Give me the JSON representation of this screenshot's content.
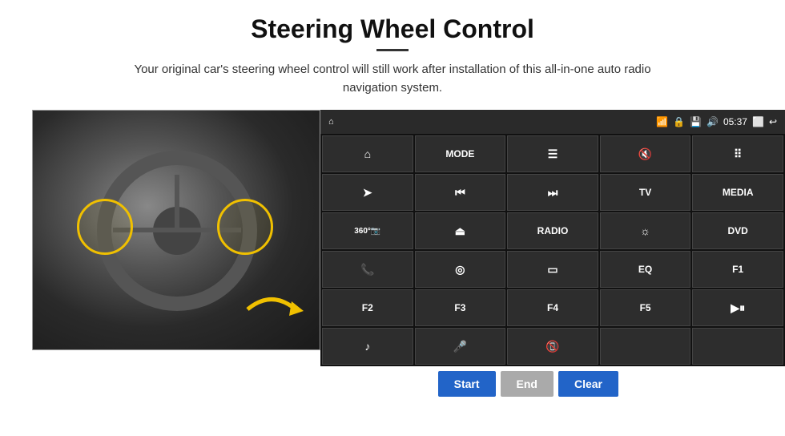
{
  "header": {
    "title": "Steering Wheel Control",
    "subtitle": "Your original car's steering wheel control will still work after installation of this all-in-one auto radio navigation system."
  },
  "status_bar": {
    "wifi_icon": "wifi",
    "lock_icon": "🔒",
    "sd_icon": "💾",
    "bt_icon": "🔊",
    "time": "05:37",
    "screen_icon": "⬜",
    "back_icon": "↩"
  },
  "grid_cells": [
    {
      "id": "home",
      "label": "⌂",
      "type": "icon"
    },
    {
      "id": "mode",
      "label": "MODE",
      "type": "text"
    },
    {
      "id": "list",
      "label": "☰",
      "type": "icon"
    },
    {
      "id": "mute",
      "label": "🔇",
      "type": "icon"
    },
    {
      "id": "apps",
      "label": "⋮⋮",
      "type": "icon"
    },
    {
      "id": "nav",
      "label": "➤",
      "type": "icon"
    },
    {
      "id": "prev",
      "label": "⏮",
      "type": "icon"
    },
    {
      "id": "next",
      "label": "⏭",
      "type": "icon"
    },
    {
      "id": "tv",
      "label": "TV",
      "type": "text"
    },
    {
      "id": "media",
      "label": "MEDIA",
      "type": "text"
    },
    {
      "id": "360cam",
      "label": "360°",
      "type": "icon"
    },
    {
      "id": "eject",
      "label": "⏏",
      "type": "icon"
    },
    {
      "id": "radio",
      "label": "RADIO",
      "type": "text"
    },
    {
      "id": "brightness",
      "label": "☼",
      "type": "icon"
    },
    {
      "id": "dvd",
      "label": "DVD",
      "type": "text"
    },
    {
      "id": "phone",
      "label": "📞",
      "type": "icon"
    },
    {
      "id": "swipe",
      "label": "◎",
      "type": "icon"
    },
    {
      "id": "rect",
      "label": "▭",
      "type": "icon"
    },
    {
      "id": "eq",
      "label": "EQ",
      "type": "text"
    },
    {
      "id": "f1",
      "label": "F1",
      "type": "text"
    },
    {
      "id": "f2",
      "label": "F2",
      "type": "text"
    },
    {
      "id": "f3",
      "label": "F3",
      "type": "text"
    },
    {
      "id": "f4",
      "label": "F4",
      "type": "text"
    },
    {
      "id": "f5",
      "label": "F5",
      "type": "text"
    },
    {
      "id": "playpause",
      "label": "▶⏸",
      "type": "icon"
    },
    {
      "id": "music",
      "label": "♪",
      "type": "icon"
    },
    {
      "id": "mic",
      "label": "🎤",
      "type": "icon"
    },
    {
      "id": "hangup",
      "label": "📵",
      "type": "icon"
    },
    {
      "id": "empty1",
      "label": "",
      "type": "empty"
    },
    {
      "id": "empty2",
      "label": "",
      "type": "empty"
    }
  ],
  "buttons": {
    "start": "Start",
    "end": "End",
    "clear": "Clear"
  }
}
